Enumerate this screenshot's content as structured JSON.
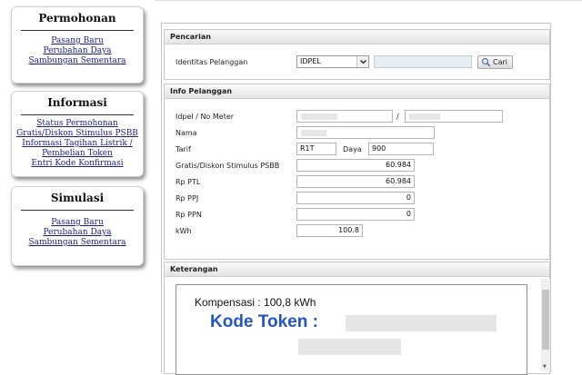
{
  "sidebar": {
    "permohonan": {
      "title": "Permohonan",
      "links": [
        "Pasang Baru",
        "Perubahan Daya",
        "Sambungan Sementara"
      ]
    },
    "informasi": {
      "title": "Informasi",
      "links": [
        "Status Permohonan",
        "Gratis/Diskon Stimulus PSBB",
        "Informasi Tagihan Listrik /",
        "Pembelian Token",
        "Entri Kode Konfirmasi"
      ]
    },
    "simulasi": {
      "title": "Simulasi",
      "links": [
        "Pasang Baru",
        "Perubahan Daya",
        "Sambungan Sementara"
      ]
    }
  },
  "pencarian": {
    "title": "Pencarian",
    "label": "Identitas Pelanggan",
    "select_value": "IDPEL",
    "search_value": "",
    "button": "Cari"
  },
  "info": {
    "title": "Info Pelanggan",
    "labels": {
      "idpel": "Idpel / No Meter",
      "nama": "Nama",
      "tarif": "Tarif",
      "daya": "Daya",
      "gratis": "Gratis/Diskon Stimulus PSBB",
      "ptl": "Rp PTL",
      "ppj": "Rp PPJ",
      "ppn": "Rp PPN",
      "kwh": "kWh"
    },
    "separator": "/",
    "values": {
      "tarif": "R1T",
      "daya": "900",
      "gratis": "60.984",
      "ptl": "60.984",
      "ppj": "0",
      "ppn": "0",
      "kwh": "100.8"
    }
  },
  "keterangan": {
    "title": "Keterangan",
    "kompensasi": "Kompensasi : 100,8 kWh",
    "token_label": "Kode Token :"
  }
}
